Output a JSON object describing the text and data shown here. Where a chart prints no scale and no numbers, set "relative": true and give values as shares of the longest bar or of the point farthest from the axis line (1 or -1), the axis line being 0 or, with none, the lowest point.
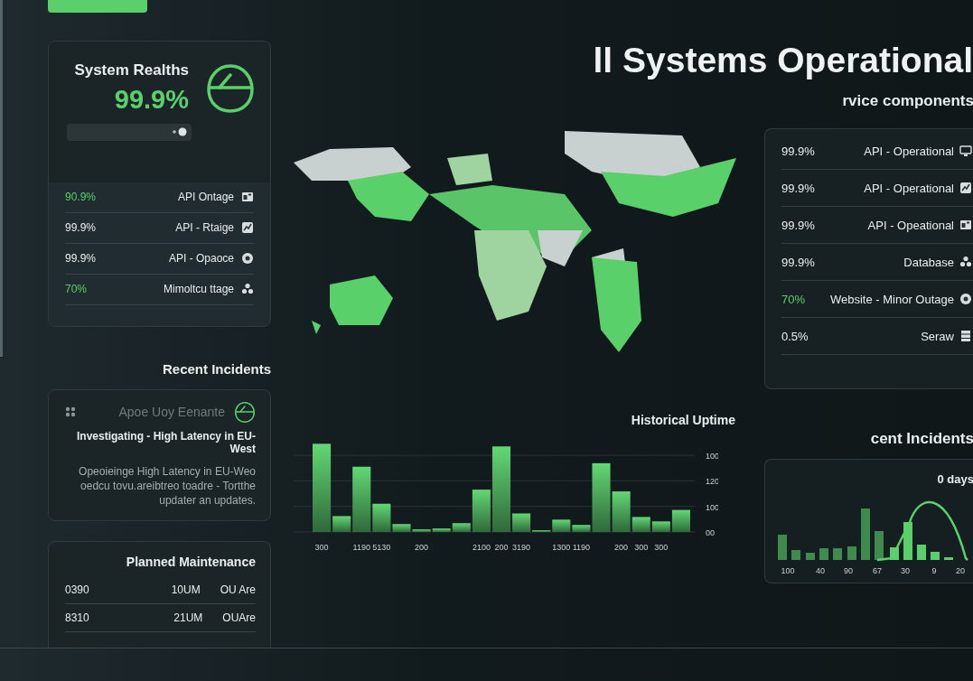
{
  "title": "ll Systems Operational",
  "health": {
    "title": "System Realths",
    "value": "99.9%",
    "rows": [
      {
        "name": "API Ontage",
        "value": "90.9%",
        "highlighted": true
      },
      {
        "name": "API - Rtaige",
        "value": "99.9%",
        "highlighted": false
      },
      {
        "name": "API - Opaoce",
        "value": "99.9%",
        "highlighted": false
      },
      {
        "name": "Mimoltcu ttage",
        "value": "70%",
        "highlighted": true
      }
    ]
  },
  "recent_incidents": {
    "heading": "Recent Incidents",
    "source": "Apoe Uoy Eenante",
    "title": "Investigating - High Latency in EU-West",
    "body": "Opeoieinge High Latency in EU-Weo oedcu tovu.areibtreo toadre - Tortthe updater an updates."
  },
  "maintenance": {
    "title": "Planned Maintenance",
    "rows": [
      {
        "name": "OU Are",
        "unit": "10UM",
        "value": "0390"
      },
      {
        "name": "OUAre",
        "unit": "21UM",
        "value": "8310"
      }
    ]
  },
  "uptime": {
    "chart_data": {
      "type": "bar",
      "title": "Historical Uptime",
      "relative": true,
      "categories": [
        "300",
        null,
        "1190",
        "5130",
        null,
        "200",
        null,
        null,
        "2100",
        "200",
        "3190",
        null,
        "1300",
        "1190",
        null,
        "200",
        "300",
        "300",
        null
      ],
      "values": [
        1,
        0.18,
        0.74,
        0.32,
        0.09,
        0.03,
        0.04,
        0.1,
        0.48,
        0.97,
        0.21,
        0.02,
        0.14,
        0.08,
        0.78,
        0.46,
        0.17,
        0.12,
        0.25
      ]
    },
    "y_labels": [
      "100",
      "120",
      "100",
      "00"
    ]
  },
  "components": {
    "heading": "rvice components",
    "items": [
      {
        "name": "API - Operational",
        "value": "99.9%",
        "highlighted": false
      },
      {
        "name": "API - Operational",
        "value": "99.9%",
        "highlighted": false
      },
      {
        "name": "API - Opeational",
        "value": "99.9%",
        "highlighted": false
      },
      {
        "name": "Database",
        "value": "99.9%",
        "highlighted": false
      },
      {
        "name": "Website - Minor Outage",
        "value": "70%",
        "highlighted": true
      },
      {
        "name": "Seraw",
        "value": "0.5%",
        "highlighted": false
      }
    ]
  },
  "incident_history": {
    "heading": "cent Incidents",
    "title": "0 days",
    "x_labels": [
      "100",
      "40",
      "90",
      "67",
      "30",
      "9",
      "20"
    ]
  }
}
